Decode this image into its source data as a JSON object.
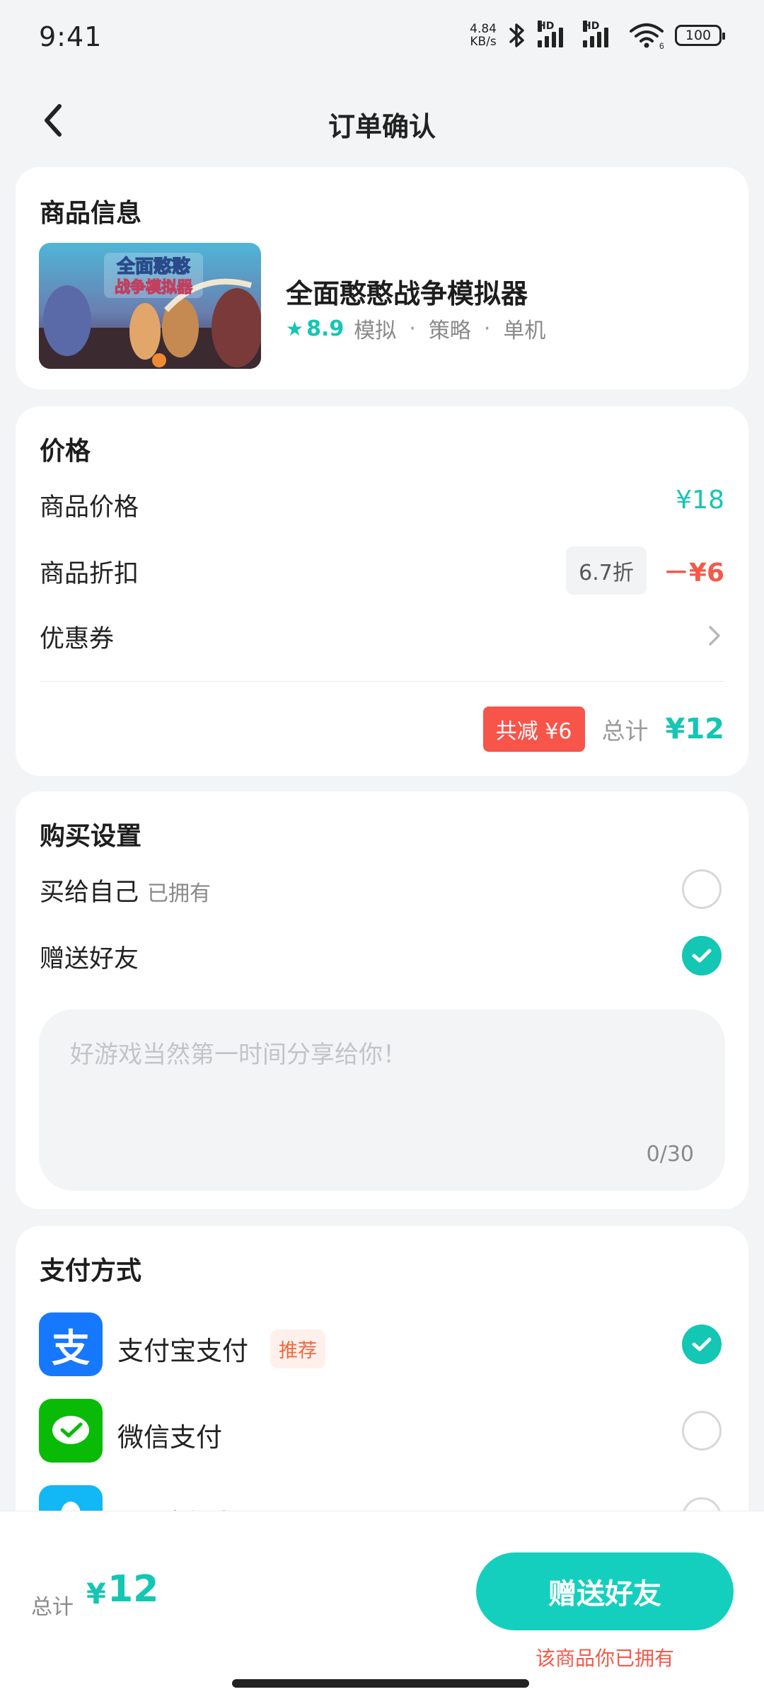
{
  "status_bar": {
    "time": "9:41",
    "net_speed_value": "4.84",
    "net_speed_unit": "KB/s",
    "hd": "HD",
    "wifi_sub": "6",
    "battery": "100"
  },
  "header": {
    "title": "订单确认"
  },
  "product": {
    "section_title": "商品信息",
    "name": "全面憨憨战争模拟器",
    "rating": "8.9",
    "tags": [
      "模拟",
      "策略",
      "单机"
    ],
    "thumb_title_line1": "全面憨憨",
    "thumb_title_line2": "战争模拟器"
  },
  "price": {
    "section_title": "价格",
    "item_price_label": "商品价格",
    "item_price_value": "¥18",
    "discount_label": "商品折扣",
    "discount_chip": "6.7折",
    "discount_value": "－¥6",
    "coupon_label": "优惠券",
    "saved_badge": "共减 ¥6",
    "total_label": "总计",
    "total_value": "¥12"
  },
  "purchase": {
    "section_title": "购买设置",
    "self_label": "买给自己",
    "self_tag": "已拥有",
    "gift_label": "赠送好友",
    "message_placeholder": "好游戏当然第一时间分享给你！",
    "message_count": "0/30"
  },
  "payment": {
    "section_title": "支付方式",
    "methods": [
      {
        "label": "支付宝支付",
        "tag": "推荐",
        "selected": true
      },
      {
        "label": "微信支付",
        "selected": false
      },
      {
        "label": "QQ钱包支付",
        "selected": false
      }
    ]
  },
  "bottom": {
    "total_label": "总计",
    "currency": "¥",
    "total_value": "12",
    "gift_button": "赠送好友",
    "owned_note": "该商品你已拥有"
  },
  "colors": {
    "accent": "#14c6b4",
    "discount_red": "#f35a4a",
    "alipay_blue": "#1677ff",
    "wechat_green": "#09bb07",
    "qq_blue": "#12b7f5"
  }
}
